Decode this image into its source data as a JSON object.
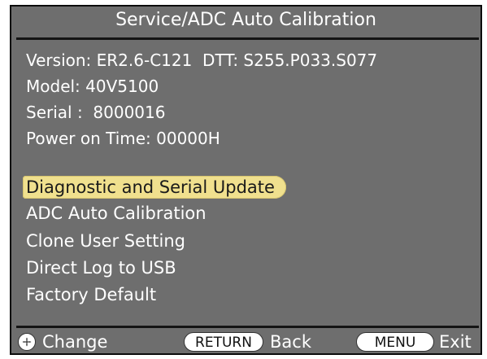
{
  "screen": {
    "title": "Service/ADC Auto Calibration",
    "info": {
      "version": "Version: ER2.6-C121  DTT: S255.P033.S077",
      "model": "Model: 40V5100",
      "serial": "Serial :  8000016",
      "power_on_time": "Power on Time: 00000H"
    },
    "menu": [
      {
        "label": "Diagnostic and Serial Update",
        "selected": true
      },
      {
        "label": "ADC Auto Calibration",
        "selected": false
      },
      {
        "label": "Clone User Setting",
        "selected": false
      },
      {
        "label": "Direct Log to USB",
        "selected": false
      },
      {
        "label": "Factory Default",
        "selected": false
      }
    ],
    "footer": {
      "change_icon": "directional-pad-icon",
      "change_label": "Change",
      "return_key": "RETURN",
      "back_label": "Back",
      "menu_key": "MENU",
      "exit_label": "Exit"
    },
    "colors": {
      "background": "#6e6e6e",
      "highlight": "#f0e08e",
      "text": "#ffffff"
    }
  }
}
